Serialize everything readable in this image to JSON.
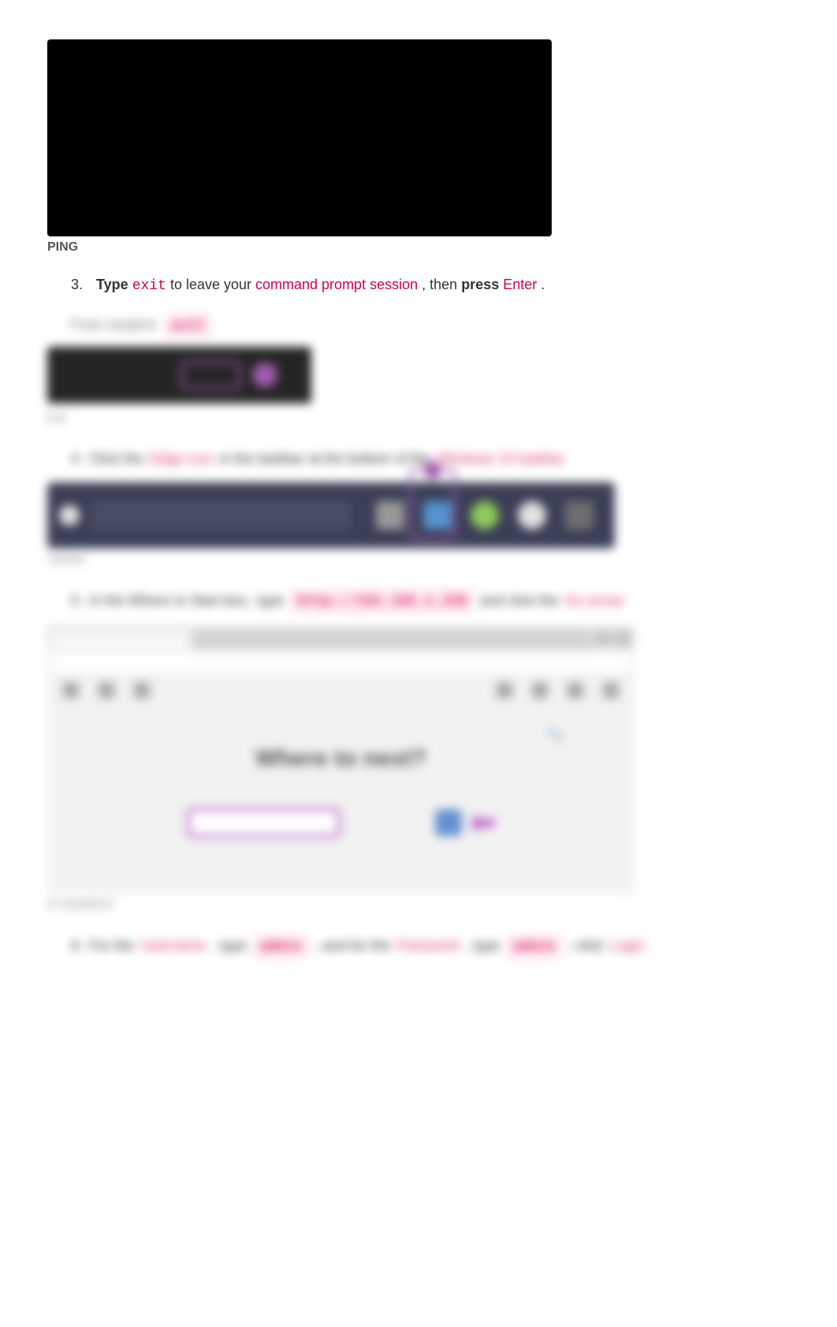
{
  "topTerminal": {
    "caption": "PING"
  },
  "step3": {
    "num": "3.",
    "t1": "Type",
    "cmd": "exit",
    "t2": "to leave your",
    "link": "command prompt session",
    "t3": ", then",
    "t4": "press",
    "key": "Enter",
    "t5": "."
  },
  "blurredRow1": {
    "label1": "From student:",
    "cmd": "exit"
  },
  "smallTerm": {
    "caption": "Exit"
  },
  "step4": {
    "num": "4.",
    "t1": "Click the",
    "link": "Edge icon",
    "t2": "in the taskbar at the bottom of the",
    "link2": "Windows 10 taskbar"
  },
  "taskbarCaption": "Taskbar",
  "step5": {
    "num": "5.",
    "t1": "In the Where to Start box,",
    "t2": "type",
    "url": "http://192.168.1.250",
    "t3": "and click the",
    "link": "Go arrow"
  },
  "browser": {
    "title": "Where to next?",
    "caption": "IP ADDRESS"
  },
  "step6": {
    "num": "6.",
    "t1": "For the",
    "f1": "Username",
    "t2": ", type",
    "v1": "admin",
    "t3": "; and for the",
    "f2": "Password",
    "t4": ", type",
    "v2": "admin",
    "t5": "; click",
    "btn": "Login"
  }
}
